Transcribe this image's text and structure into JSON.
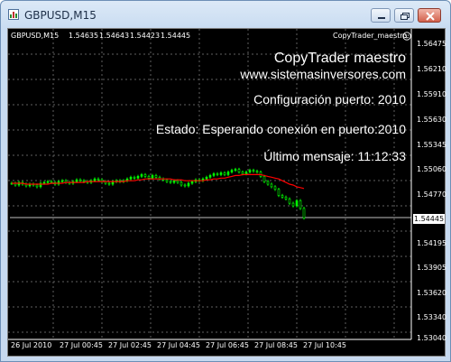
{
  "window": {
    "title": "GBPUSD,M15",
    "controls": [
      "minimize",
      "maximize",
      "close"
    ]
  },
  "chart_header": {
    "symbol": "GBPUSD,M15",
    "open": "1.54635",
    "high": "1.54643",
    "low": "1.54423",
    "close": "1.54445",
    "expert_name": "CopyTrader_maestro",
    "expert_icon": "smiley-icon"
  },
  "overlay": {
    "product": "CopyTrader maestro",
    "website": "www.sistemasinversores.com",
    "config": "Configuración puerto: 2010",
    "status": "Estado: Esperando conexión en puerto:2010",
    "last_message": "Último mensaje: 11:12:33"
  },
  "colors": {
    "background": "#000000",
    "grid": "#5f5f5f",
    "bull_candle": "#00ff00",
    "moving_average": "#ff0000",
    "text": "#ffffff",
    "bid_line": "#c0c0c0"
  },
  "current_price": "1.54445",
  "y_axis": [
    "1.56475",
    "1.56210",
    "1.55910",
    "1.55630",
    "1.55345",
    "1.55060",
    "1.54770",
    "1.54445",
    "1.54195",
    "1.53905",
    "1.53620",
    "1.53340",
    "1.53040"
  ],
  "x_axis": [
    "26 Jul 2010",
    "27 Jul 00:45",
    "27 Jul 02:45",
    "27 Jul 04:45",
    "27 Jul 06:45",
    "27 Jul 08:45",
    "27 Jul 10:45"
  ],
  "chart_data": {
    "type": "candlestick",
    "symbol": "GBPUSD",
    "timeframe": "M15",
    "ylim": [
      1.5304,
      1.5662
    ],
    "close": [
      1.5484,
      1.5482,
      1.5485,
      1.5483,
      1.5481,
      1.5483,
      1.5482,
      1.548,
      1.5484,
      1.5485,
      1.5486,
      1.5485,
      1.5483,
      1.5486,
      1.5487,
      1.5485,
      1.5484,
      1.5486,
      1.5488,
      1.5487,
      1.5486,
      1.5485,
      1.5487,
      1.5489,
      1.5488,
      1.5486,
      1.5484,
      1.5483,
      1.5486,
      1.5487,
      1.5486,
      1.5487,
      1.5489,
      1.5491,
      1.549,
      1.5492,
      1.5494,
      1.5492,
      1.549,
      1.5493,
      1.5491,
      1.5489,
      1.5488,
      1.5486,
      1.5485,
      1.5487,
      1.5485,
      1.5482,
      1.5481,
      1.5484,
      1.5486,
      1.5488,
      1.5487,
      1.5489,
      1.5491,
      1.5493,
      1.5495,
      1.5494,
      1.5496,
      1.5494,
      1.5497,
      1.5499,
      1.55,
      1.5497,
      1.5495,
      1.5497,
      1.5499,
      1.5498,
      1.5497,
      1.5492,
      1.5486,
      1.5483,
      1.548,
      1.5477,
      1.547,
      1.5468,
      1.5466,
      1.5461,
      1.5458,
      1.5464,
      1.5455,
      1.5444
    ],
    "moving_average": [
      1.5484,
      1.5484,
      1.5484,
      1.5484,
      1.5483,
      1.5483,
      1.5483,
      1.5483,
      1.5483,
      1.5483,
      1.5483,
      1.5484,
      1.5484,
      1.5484,
      1.5484,
      1.5485,
      1.5485,
      1.5485,
      1.5485,
      1.5485,
      1.5485,
      1.5486,
      1.5486,
      1.5486,
      1.5486,
      1.5486,
      1.5486,
      1.5486,
      1.5486,
      1.5486,
      1.5486,
      1.5486,
      1.5487,
      1.5487,
      1.5487,
      1.5488,
      1.5488,
      1.5489,
      1.5489,
      1.5489,
      1.5489,
      1.5489,
      1.5489,
      1.5489,
      1.5489,
      1.5488,
      1.5488,
      1.5488,
      1.5487,
      1.5487,
      1.5487,
      1.5487,
      1.5487,
      1.5487,
      1.5488,
      1.5488,
      1.5489,
      1.5489,
      1.549,
      1.549,
      1.5491,
      1.5492,
      1.5493,
      1.5493,
      1.5494,
      1.5494,
      1.5494,
      1.5494,
      1.5494,
      1.5494,
      1.5493,
      1.5492,
      1.5491,
      1.549,
      1.5489,
      1.5487,
      1.5485,
      1.5483,
      1.5482,
      1.548,
      1.5479,
      1.5478
    ]
  }
}
